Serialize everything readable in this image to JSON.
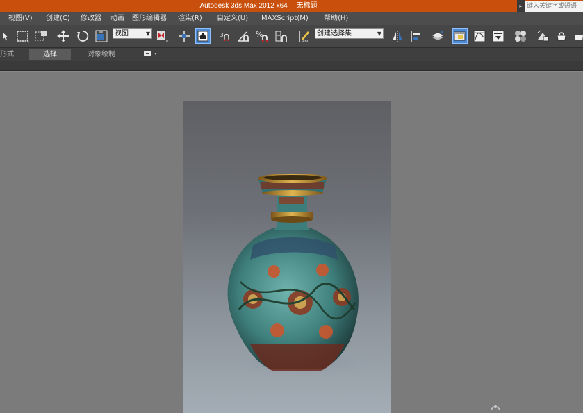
{
  "titlebar": {
    "app_title": "Autodesk 3ds Max  2012 x64",
    "doc_title": "无标题",
    "search_placeholder": "键入关键字或短语",
    "bg_color": "#c9500c"
  },
  "menu": {
    "items": [
      {
        "label": "视图(V)"
      },
      {
        "label": "创建(C)"
      },
      {
        "label": "修改器"
      },
      {
        "label": "动画"
      },
      {
        "label": "图形编辑器"
      },
      {
        "label": "渲染(R)"
      },
      {
        "label": "自定义(U)"
      },
      {
        "label": "MAXScript(M)"
      },
      {
        "label": "帮助(H)"
      }
    ]
  },
  "toolbar": {
    "coord_dropdown": "视图",
    "selection_set_dropdown": "创建选择集",
    "snap_label": "3",
    "percent_label": "%",
    "accent_color": "#4e8ad2"
  },
  "ribbon": {
    "tabs": [
      {
        "label": "形式"
      },
      {
        "label": "选择"
      },
      {
        "label": "对象绘制"
      }
    ]
  },
  "viewport": {
    "image_subject": "cloisonne-vase-icon"
  }
}
